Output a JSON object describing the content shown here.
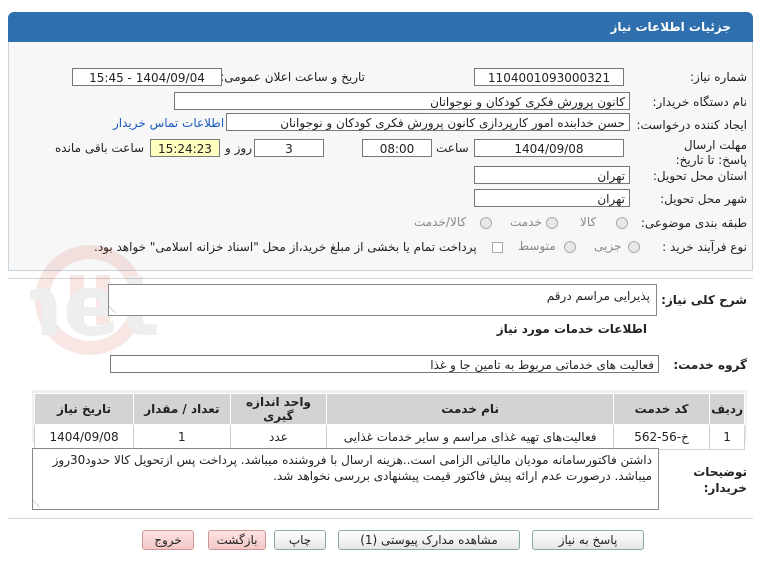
{
  "header": {
    "title": "جزئیات اطلاعات نیاز"
  },
  "fields": {
    "need_number_label": "شماره نیاز:",
    "need_number": "1104001093000321",
    "announce_label": "تاریخ و ساعت اعلان عمومی:",
    "announce_value": "1404/09/04 - 15:45",
    "buyer_org_label": "نام دستگاه خریدار:",
    "buyer_org": "کانون پرورش فکری کودکان و نوجوانان",
    "requester_label": "ایجاد کننده درخواست:",
    "requester": "حسن خدابنده امور کارپردازی  کانون پرورش فکری کودکان و نوجوانان",
    "contact_link": "اطلاعات تماس خریدار",
    "deadline_label": "مهلت ارسال پاسخ: تا تاریخ:",
    "deadline_date": "1404/09/08",
    "time_label": "ساعت",
    "deadline_time": "08:00",
    "day_and_label": "روز و",
    "days": "3",
    "remaining_time": "15:24:23",
    "remaining_label": "ساعت باقی مانده",
    "province_label": "استان محل تحویل:",
    "province": "تهران",
    "city_label": "شهر محل تحویل:",
    "city": "تهران",
    "category_label": "طبقه بندی موضوعی:",
    "category_options": [
      "کالا",
      "خدمت",
      "کالا/خدمت"
    ],
    "process_label": "نوع فرآیند خرید :",
    "process_options": [
      "جزیی",
      "متوسط"
    ],
    "treasury_note": "پرداخت تمام یا بخشی از مبلغ خرید،از محل \"اسناد خزانه اسلامی\" خواهد بود."
  },
  "summary": {
    "label": "شرح کلی نیاز:",
    "value": "پذیرایی مراسم درقم"
  },
  "services": {
    "section_title": "اطلاعات خدمات مورد نیاز",
    "group_label": "گروه خدمت:",
    "group_value": "فعالیت های خدماتی مربوط به تامین جا و غذا",
    "columns": [
      "ردیف",
      "کد خدمت",
      "نام خدمت",
      "واحد اندازه گیری",
      "تعداد / مقدار",
      "تاریخ نیاز"
    ],
    "rows": [
      [
        "1",
        "خ-56-562",
        "فعالیت‌های تهیه غذای مراسم و سایر خدمات غذایی",
        "عدد",
        "1",
        "1404/09/08"
      ]
    ]
  },
  "buyer_notes": {
    "label_line1": "توضیحات",
    "label_line2": "خریدار:",
    "text": "داشتن فاکتورسامانه مودیان مالیاتی الزامی است..هزینه ارسال با فروشنده میباشد. پرداخت پس ازتحویل کالا حدود30روز میباشد. درصورت عدم ارائه پیش فاکتور قیمت پیشنهادی بررسی نخواهد شد."
  },
  "buttons": {
    "reply": "پاسخ به نیاز",
    "attachments": "مشاهده مدارک پیوستی (1)",
    "print": "چاپ",
    "back": "بازگشت",
    "exit": "خروج"
  },
  "watermark": {
    "text": "AriaTender.net"
  },
  "colors": {
    "header_bg": "#2f6fae",
    "link": "#1a5bbf",
    "remaining_bg": "#ffffc0"
  }
}
